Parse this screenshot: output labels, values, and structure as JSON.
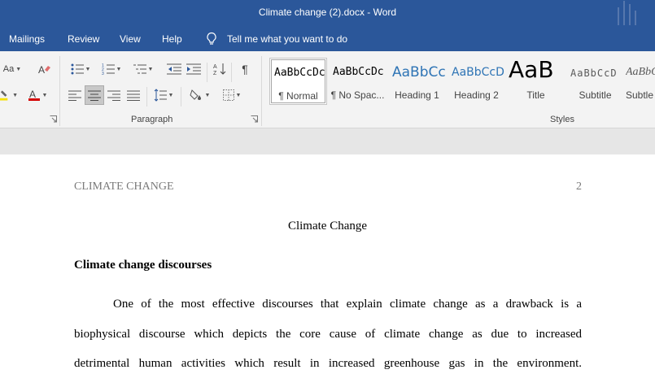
{
  "window": {
    "title": "Climate change (2).docx  -  Word"
  },
  "ribbon_tabs": [
    {
      "label": "Mailings"
    },
    {
      "label": "Review"
    },
    {
      "label": "View"
    },
    {
      "label": "Help"
    }
  ],
  "tell_me": {
    "label": "Tell me what you want to do",
    "icon": "lightbulb-icon"
  },
  "ribbon": {
    "font_group": {
      "font_size_label": "Aa",
      "icons": [
        "change-case-icon",
        "clear-formatting-icon",
        "highlight-color-icon",
        "font-color-icon",
        "dialog-launcher-icon"
      ],
      "highlight_color": "#f5e100",
      "font_color": "#d40000"
    },
    "paragraph_group": {
      "label": "Paragraph",
      "icons": [
        "bullets-icon",
        "numbering-icon",
        "multilevel-list-icon",
        "decrease-indent-icon",
        "increase-indent-icon",
        "sort-icon",
        "show-marks-icon",
        "align-left-icon",
        "align-center-icon",
        "align-right-icon",
        "justify-icon",
        "line-spacing-icon",
        "shading-icon",
        "borders-icon"
      ],
      "selected_alignment": "center"
    },
    "styles_group": {
      "label": "Styles",
      "items": [
        {
          "preview": "AaBbCcDc",
          "name": "¶ Normal",
          "selected": true
        },
        {
          "preview": "AaBbCcDc",
          "name": "¶ No Spac..."
        },
        {
          "preview": "AaBbCc",
          "name": "Heading 1",
          "color": "#2e74b5"
        },
        {
          "preview": "AaBbCcD",
          "name": "Heading 2",
          "color": "#2e74b5"
        },
        {
          "preview": "AaB",
          "name": "Title"
        },
        {
          "preview": "AaBbCcD",
          "name": "Subtitle",
          "color": "#595959"
        },
        {
          "preview": "AaBbCc",
          "name": "Subtle"
        }
      ]
    }
  },
  "document": {
    "header_text": "CLIMATE CHANGE",
    "page_number": "2",
    "title": "Climate Change",
    "heading": "Climate change discourses",
    "paragraph_lines": [
      "One of the most effective discourses that explain climate change as a drawback is a",
      "biophysical discourse which depicts the core cause of climate change as due to increased",
      "detrimental human activities which result in increased greenhouse gas in the environment."
    ]
  }
}
